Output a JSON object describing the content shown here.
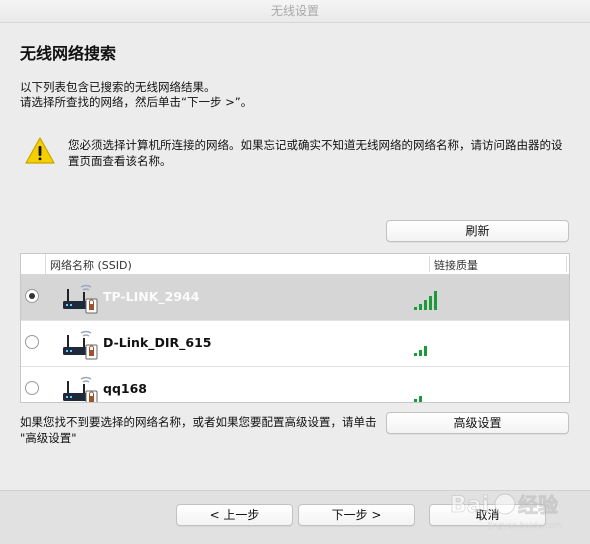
{
  "window": {
    "title": "无线设置"
  },
  "page": {
    "title": "无线网络搜索",
    "intro_line1": "以下列表包含已搜索的无线网络结果。",
    "intro_line2": "请选择所查找的网络，然后单击“下一步 >”。"
  },
  "warning": {
    "icon": "warning-triangle-icon",
    "text": "您必须选择计算机所连接的网络。如果忘记或确实不知道无线网络的网络名称，请访问路由器的设置页面查看该名称。"
  },
  "buttons": {
    "refresh": "刷新",
    "advanced": "高级设置",
    "prev": "< 上一步",
    "next": "下一步 >",
    "cancel": "取消"
  },
  "table": {
    "columns": [
      "网络名称 (SSID)",
      "链接质量"
    ],
    "rows": [
      {
        "ssid": "TP-LINK_2944",
        "selected": true,
        "signal_bars": 5
      },
      {
        "ssid": "D-Link_DIR_615",
        "selected": false,
        "signal_bars": 3
      },
      {
        "ssid": "qq168",
        "selected": false,
        "signal_bars": 2
      }
    ]
  },
  "advanced_hint": "如果您找不到要选择的网络名称，或者如果您要配置高级设置，请单击 \"高级设置\"",
  "colors": {
    "selected_row": "#d6d6d6",
    "signal_green": "#1a9a3a",
    "warning_yellow": "#f5d000"
  }
}
